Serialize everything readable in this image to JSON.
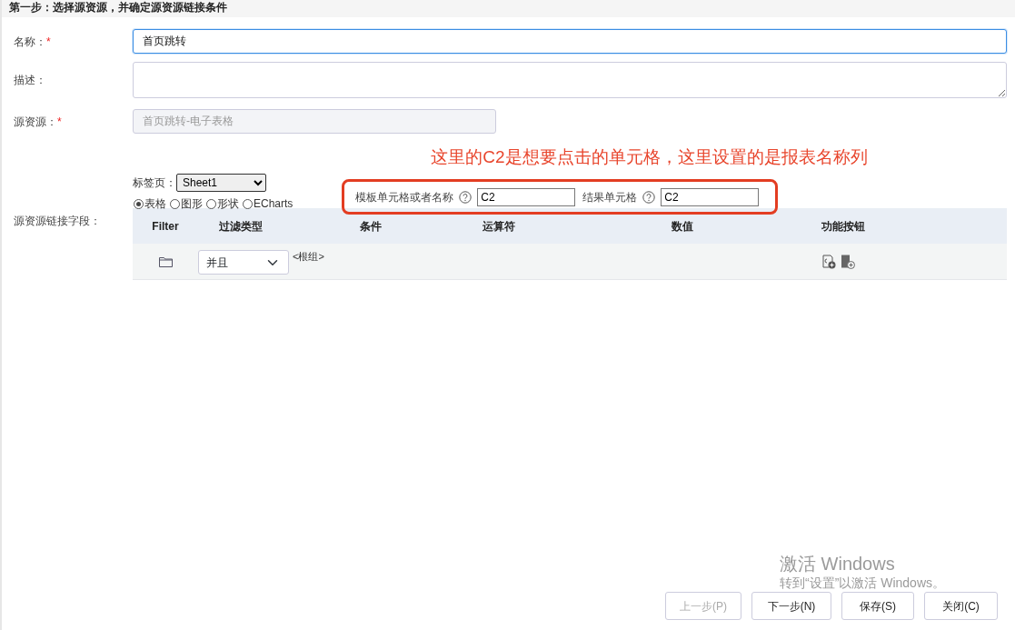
{
  "step_title": "第一步：选择源资源，并确定源资源链接条件",
  "fields": [
    {
      "kind": "input",
      "label": "名称：",
      "required_mark": "*",
      "value": "首页跳转",
      "focused": true
    },
    {
      "kind": "textarea",
      "label": "描述："
    },
    {
      "kind": "input",
      "label": "源资源：",
      "required_mark": "*",
      "value": "首页跳转-电子表格",
      "disabled": true
    }
  ],
  "annotation": "这里的C2是想要点击的单元格，这里设置的是报表名称列",
  "link_section": {
    "label": "源资源链接字段：",
    "tab_label": "标签页：",
    "tab_value": "Sheet1",
    "chart_types": [
      {
        "label": "表格",
        "selected": true
      },
      {
        "label": "图形",
        "selected": false
      },
      {
        "label": "形状",
        "selected": false
      },
      {
        "label": "ECharts",
        "selected": false
      }
    ],
    "template_cell": {
      "label": "模板单元格或者名称",
      "value": "C2"
    },
    "result_cell": {
      "label": "结果单元格",
      "value": "C2"
    }
  },
  "table": {
    "columns": [
      "Filter",
      "过滤类型",
      "条件",
      "运算符",
      "数值",
      "功能按钮"
    ],
    "rows": [
      {
        "filter_type": "并且",
        "group": "<根组>"
      }
    ]
  },
  "buttons": [
    {
      "label": "上一步(P)",
      "disabled": true
    },
    {
      "label": "下一步(N)",
      "disabled": false
    },
    {
      "label": "保存(S)",
      "disabled": false
    },
    {
      "label": "关闭(C)",
      "disabled": false
    }
  ],
  "os_overlay": {
    "title": "激活 Windows",
    "subtitle": "转到“设置”以激活 Windows。"
  }
}
